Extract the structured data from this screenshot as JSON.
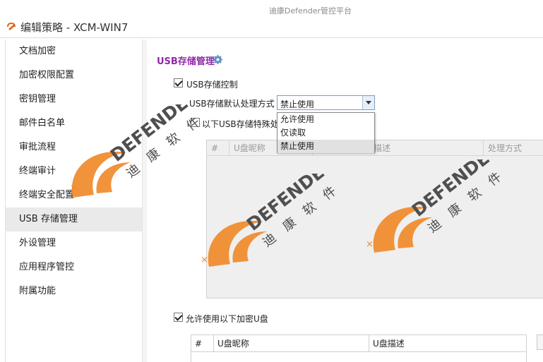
{
  "app": {
    "title": "迪康Defender管控平台"
  },
  "window": {
    "title": "编辑策略 - XCM-WIN7",
    "icon": "edit-policy-icon"
  },
  "sidebar": {
    "items": [
      {
        "label": "文档加密"
      },
      {
        "label": "加密权限配置"
      },
      {
        "label": "密钥管理"
      },
      {
        "label": "邮件白名单"
      },
      {
        "label": "审批流程"
      },
      {
        "label": "终端审计"
      },
      {
        "label": "终端安全配置"
      },
      {
        "label": "USB 存储管理"
      },
      {
        "label": "外设管理"
      },
      {
        "label": "应用程序管控"
      },
      {
        "label": "附属功能"
      }
    ],
    "active_index": 7
  },
  "main": {
    "section_title": "USB存储管理",
    "section_icon": "gear-icon",
    "usb_control": {
      "label": "USB存储控制",
      "checked": true
    },
    "default_mode": {
      "label": "USB存储默认处理方式",
      "value": "禁止使用",
      "options": [
        "允许使用",
        "仅读取",
        "禁止使用"
      ]
    },
    "special_handling": {
      "label": "以下USB存储特殊处",
      "checked": false
    },
    "special_table": {
      "columns": [
        "#",
        "U盘昵称",
        "描述",
        "处理方式"
      ]
    },
    "encrypted_usb": {
      "label": "允许使用以下加密U盘",
      "checked": true
    },
    "encrypted_table": {
      "columns": [
        "#",
        "U盘昵称",
        "U盘描述"
      ]
    }
  },
  "watermark": {
    "brand": "DEFENDER",
    "cn": [
      "迪",
      "康",
      "软",
      "件"
    ],
    "colors": {
      "orange": "#f08a2a",
      "gray": "#555555"
    }
  }
}
